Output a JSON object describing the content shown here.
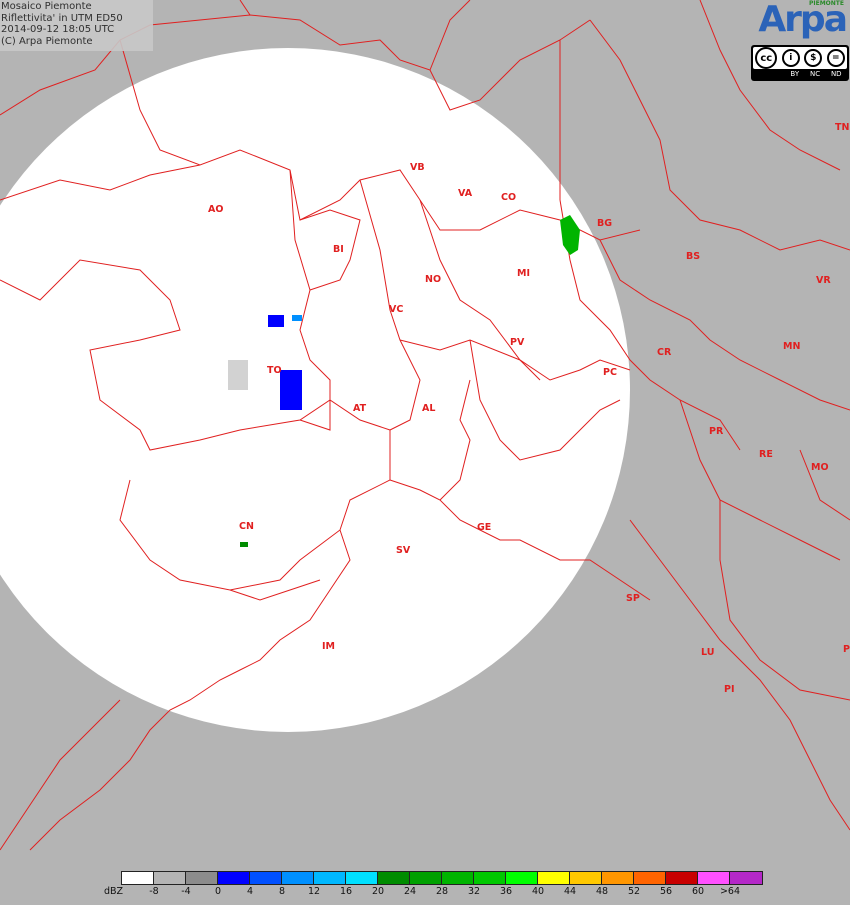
{
  "header": {
    "line1": "Mosaico Piemonte",
    "line2": "Riflettivita' in UTM ED50",
    "line3": "2014-09-12 18:05 UTC",
    "line4": "(C) Arpa Piemonte"
  },
  "logo": {
    "brand": "Arpa",
    "region": "PIEMONTE",
    "license": [
      "BY",
      "NC",
      "ND"
    ],
    "license_icons": [
      "cc-icon",
      "by-icon",
      "nc-icon",
      "nd-icon"
    ]
  },
  "provinces": [
    "VB",
    "VA",
    "CO",
    "BG",
    "AO",
    "BI",
    "MI",
    "BS",
    "VR",
    "NO",
    "TN",
    "VC",
    "PV",
    "CR",
    "MN",
    "TO",
    "PC",
    "AT",
    "AL",
    "PR",
    "RE",
    "MO",
    "CN",
    "GE",
    "SV",
    "SP",
    "IM",
    "LU",
    "PI",
    "P"
  ],
  "legend": {
    "unit": "dBZ",
    "ticks": [
      "-8",
      "-4",
      "0",
      "4",
      "8",
      "12",
      "16",
      "20",
      "24",
      "28",
      "32",
      "36",
      "40",
      "44",
      "48",
      "52",
      "56",
      "60",
      ">64"
    ],
    "colors": [
      "#ffffff",
      "#b4b4b4",
      "#8c8c8c",
      "#0000ff",
      "#0050ff",
      "#0090ff",
      "#00b8ff",
      "#00e0ff",
      "#008c00",
      "#00a000",
      "#00b400",
      "#00c800",
      "#00ff00",
      "#ffff00",
      "#ffc800",
      "#ff9600",
      "#ff6400",
      "#c80000",
      "#ff50ff",
      "#b428c8"
    ]
  },
  "colors": {
    "background": "#b4b4b4",
    "radar_coverage": "#ffffff",
    "boundaries": "#e02020"
  }
}
